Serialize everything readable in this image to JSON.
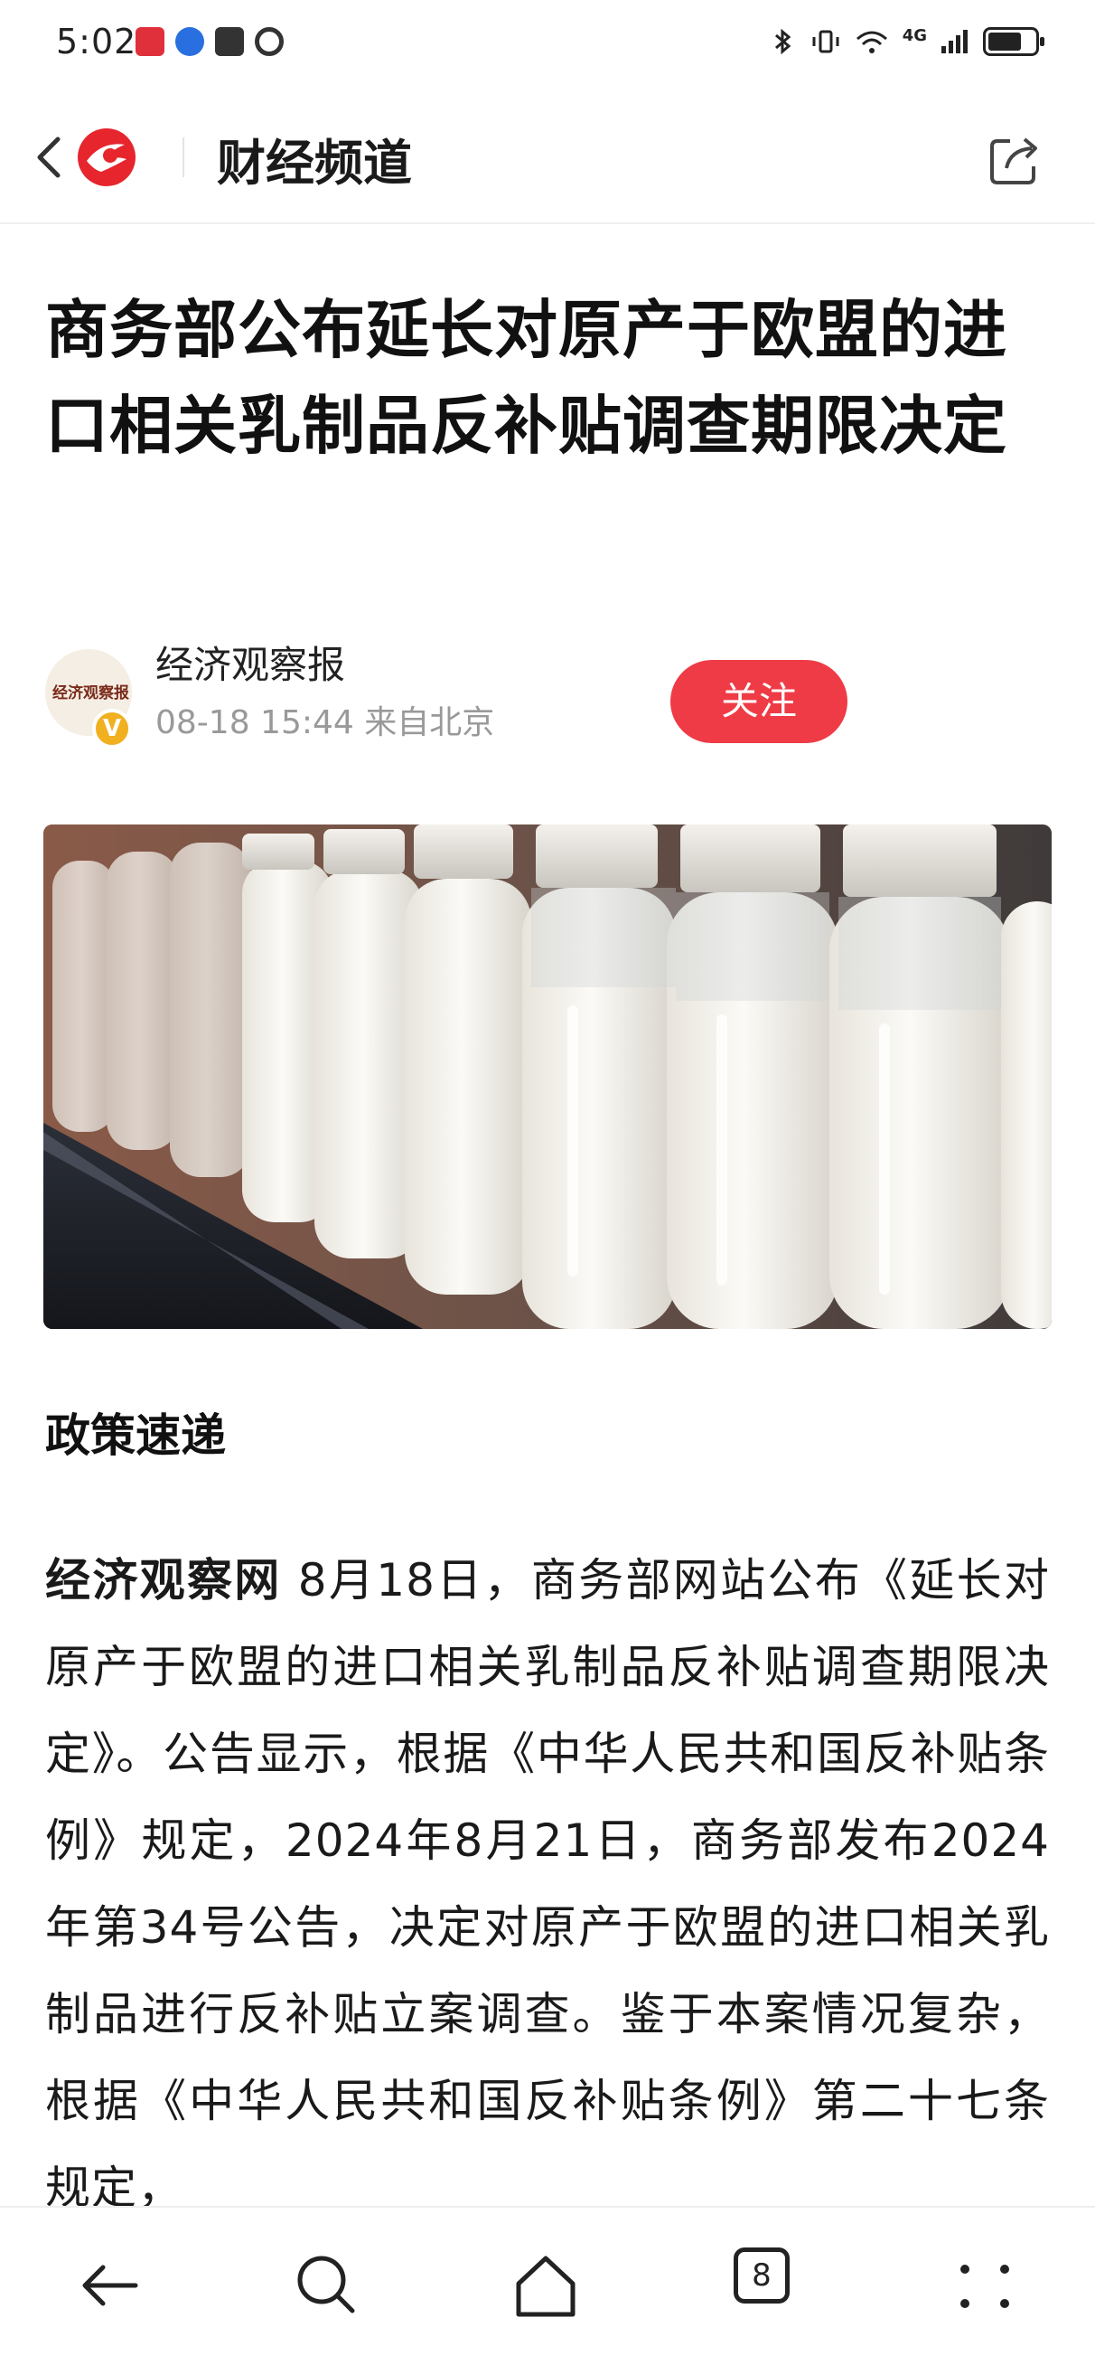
{
  "status_bar": {
    "time": "5:02",
    "network": "4G",
    "wifi_sub": "6"
  },
  "header": {
    "channel_title": "财经频道"
  },
  "article": {
    "headline": "商务部公布延长对原产于欧盟的进口相关乳制品反补贴调查期限决定",
    "author": {
      "name": "经济观察报",
      "avatar_text": "经济观察报",
      "meta": "08-18 15:44 来自北京",
      "follow_label": "关注"
    },
    "section_title": "政策速递",
    "body_lead": "经济观察网",
    "body_text": " 8月18日，商务部网站公布《延长对原产于欧盟的进口相关乳制品反补贴调查期限决定》。公告显示，根据《中华人民共和国反补贴条例》规定，2024年8月21日，商务部发布2024年第34号公告，决定对原产于欧盟的进口相关乳制品进行反补贴立案调查。鉴于本案情况复杂，根据《中华人民共和国反补贴条例》第二十七条规定，"
  },
  "bottom_nav": {
    "tabs_count": "8"
  },
  "colors": {
    "accent": "#ef3b45",
    "verify_badge": "#f0b020"
  }
}
